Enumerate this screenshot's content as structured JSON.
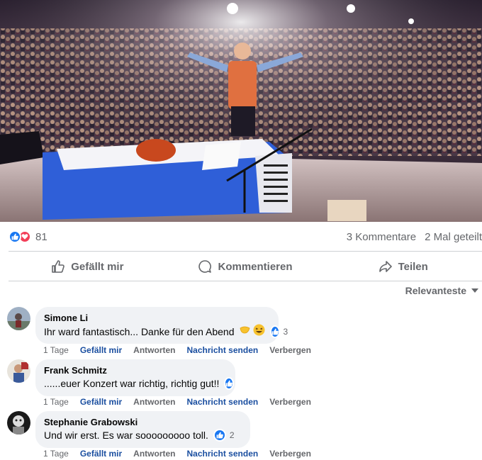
{
  "post": {
    "reactions": {
      "count": "81",
      "icons": [
        "like-icon",
        "love-icon"
      ]
    },
    "comments_count": "3 Kommentare",
    "shares_count": "2 Mal geteilt"
  },
  "actions": {
    "like_label": "Gefällt mir",
    "comment_label": "Kommentieren",
    "share_label": "Teilen"
  },
  "sort": {
    "label": "Relevanteste"
  },
  "comments": [
    {
      "author": "Simone Li",
      "text": "Ihr ward fantastisch... Danke für den Abend",
      "likes": "3",
      "time": "1 Tage",
      "like": "Gefällt mir",
      "reply": "Antworten",
      "message": "Nachricht senden",
      "hide": "Verbergen"
    },
    {
      "author": "Frank Schmitz",
      "text": "......euer Konzert war richtig, richtig gut!!",
      "likes": "",
      "time": "1 Tage",
      "like": "Gefällt mir",
      "reply": "Antworten",
      "message": "Nachricht senden",
      "hide": "Verbergen"
    },
    {
      "author": "Stephanie Grabowski",
      "text": "Und wir erst. Es war sooooooooo toll.",
      "likes": "2",
      "time": "1 Tage",
      "like": "Gefällt mir",
      "reply": "Antworten",
      "message": "Nachricht senden",
      "hide": "Verbergen"
    }
  ],
  "colors": {
    "facebook_blue": "#1877f2",
    "love_red": "#f33e58",
    "secondary_text": "#65676b",
    "bubble_bg": "#f0f2f5"
  }
}
